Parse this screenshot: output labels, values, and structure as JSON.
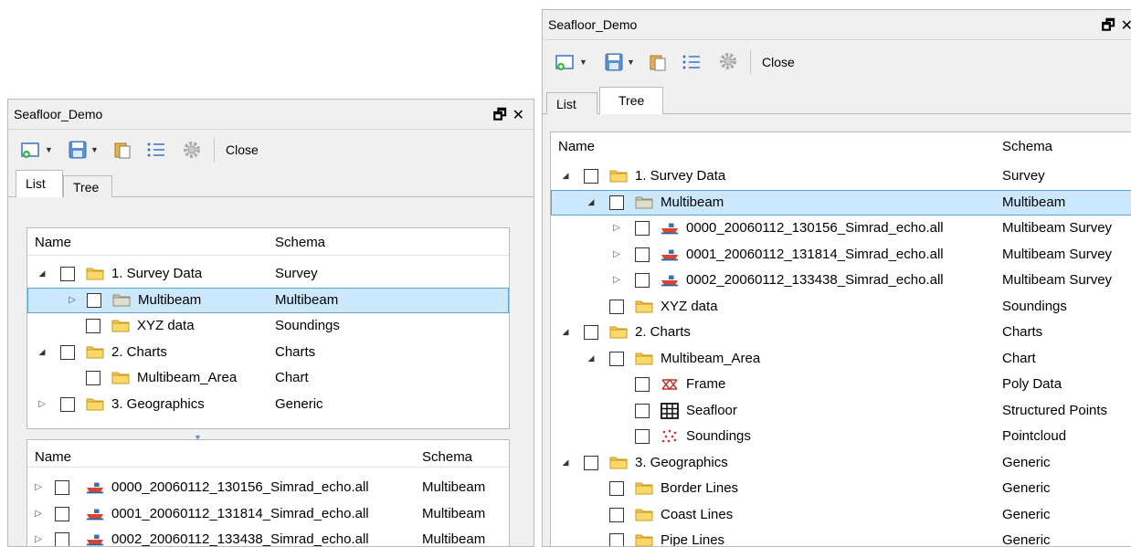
{
  "left": {
    "title": "Seafloor_Demo",
    "toolbar": {
      "close_label": "Close"
    },
    "tabs": [
      "List",
      "Tree"
    ],
    "top_tree": {
      "col_name": "Name",
      "col_schema": "Schema",
      "rows": [
        {
          "label": "1. Survey Data",
          "schema": "Survey"
        },
        {
          "label": "Multibeam",
          "schema": "Multibeam"
        },
        {
          "label": "XYZ data",
          "schema": "Soundings"
        },
        {
          "label": "2. Charts",
          "schema": "Charts"
        },
        {
          "label": "Multibeam_Area",
          "schema": "Chart"
        },
        {
          "label": "3. Geographics",
          "schema": "Generic"
        }
      ]
    },
    "bottom_list": {
      "col_name": "Name",
      "col_schema": "Schema",
      "rows": [
        {
          "label": "0000_20060112_130156_Simrad_echo.all",
          "schema": "Multibeam"
        },
        {
          "label": "0001_20060112_131814_Simrad_echo.all",
          "schema": "Multibeam"
        },
        {
          "label": "0002_20060112_133438_Simrad_echo.all",
          "schema": "Multibeam"
        }
      ]
    }
  },
  "right": {
    "title": "Seafloor_Demo",
    "toolbar": {
      "close_label": "Close"
    },
    "tabs": [
      "List",
      "Tree"
    ],
    "tree": {
      "col_name": "Name",
      "col_schema": "Schema",
      "rows": [
        {
          "label": "1. Survey Data",
          "schema": "Survey"
        },
        {
          "label": "Multibeam",
          "schema": "Multibeam"
        },
        {
          "label": "0000_20060112_130156_Simrad_echo.all",
          "schema": "Multibeam Survey"
        },
        {
          "label": "0001_20060112_131814_Simrad_echo.all",
          "schema": "Multibeam Survey"
        },
        {
          "label": "0002_20060112_133438_Simrad_echo.all",
          "schema": "Multibeam Survey"
        },
        {
          "label": "XYZ data",
          "schema": "Soundings"
        },
        {
          "label": "2. Charts",
          "schema": "Charts"
        },
        {
          "label": "Multibeam_Area",
          "schema": "Chart"
        },
        {
          "label": "Frame",
          "schema": "Poly Data"
        },
        {
          "label": "Seafloor",
          "schema": "Structured Points"
        },
        {
          "label": "Soundings",
          "schema": "Pointcloud"
        },
        {
          "label": "3. Geographics",
          "schema": "Generic"
        },
        {
          "label": "Border Lines",
          "schema": "Generic"
        },
        {
          "label": "Coast Lines",
          "schema": "Generic"
        },
        {
          "label": "Pipe Lines",
          "schema": "Generic"
        }
      ]
    }
  },
  "colors": {
    "selection_bg": "#cce8ff",
    "selection_border": "#5aa3d8",
    "folder": "#f5c84c",
    "panel_bg": "#f0f0f0"
  }
}
